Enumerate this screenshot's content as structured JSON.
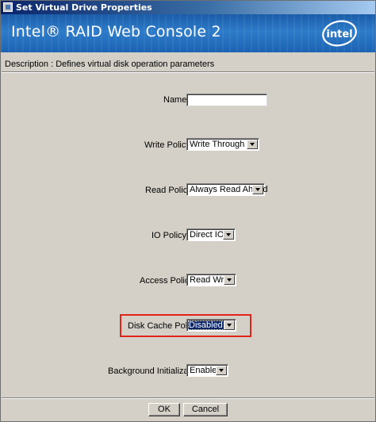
{
  "window": {
    "title": "Set Virtual Drive Properties"
  },
  "banner": {
    "product_name": "Intel® RAID Web Console 2",
    "logo_text": "intel",
    "logo_icon": "intel-logo-icon"
  },
  "description": "Description : Defines virtual disk operation parameters",
  "form": {
    "name": {
      "label": "Name:",
      "value": ""
    },
    "write_policy": {
      "label": "Write Policy:",
      "value": "Write Through"
    },
    "read_policy": {
      "label": "Read Policy:",
      "value": "Always Read Ahead"
    },
    "io_policy": {
      "label": "IO Policy :",
      "value": "Direct IO"
    },
    "access_policy": {
      "label": "Access Policy:",
      "value": "Read Write"
    },
    "disk_cache_policy": {
      "label": "Disk Cache Policy:",
      "value": "Disabled"
    },
    "background_initialization": {
      "label": "Background Initialization:",
      "value": "Enabled"
    }
  },
  "buttons": {
    "ok": "OK",
    "cancel": "Cancel"
  },
  "colors": {
    "highlight_box": "#e2231a",
    "titlebar": "#0a246a",
    "banner": "#1f6cbf",
    "dialog_background": "#d4d0c8"
  }
}
